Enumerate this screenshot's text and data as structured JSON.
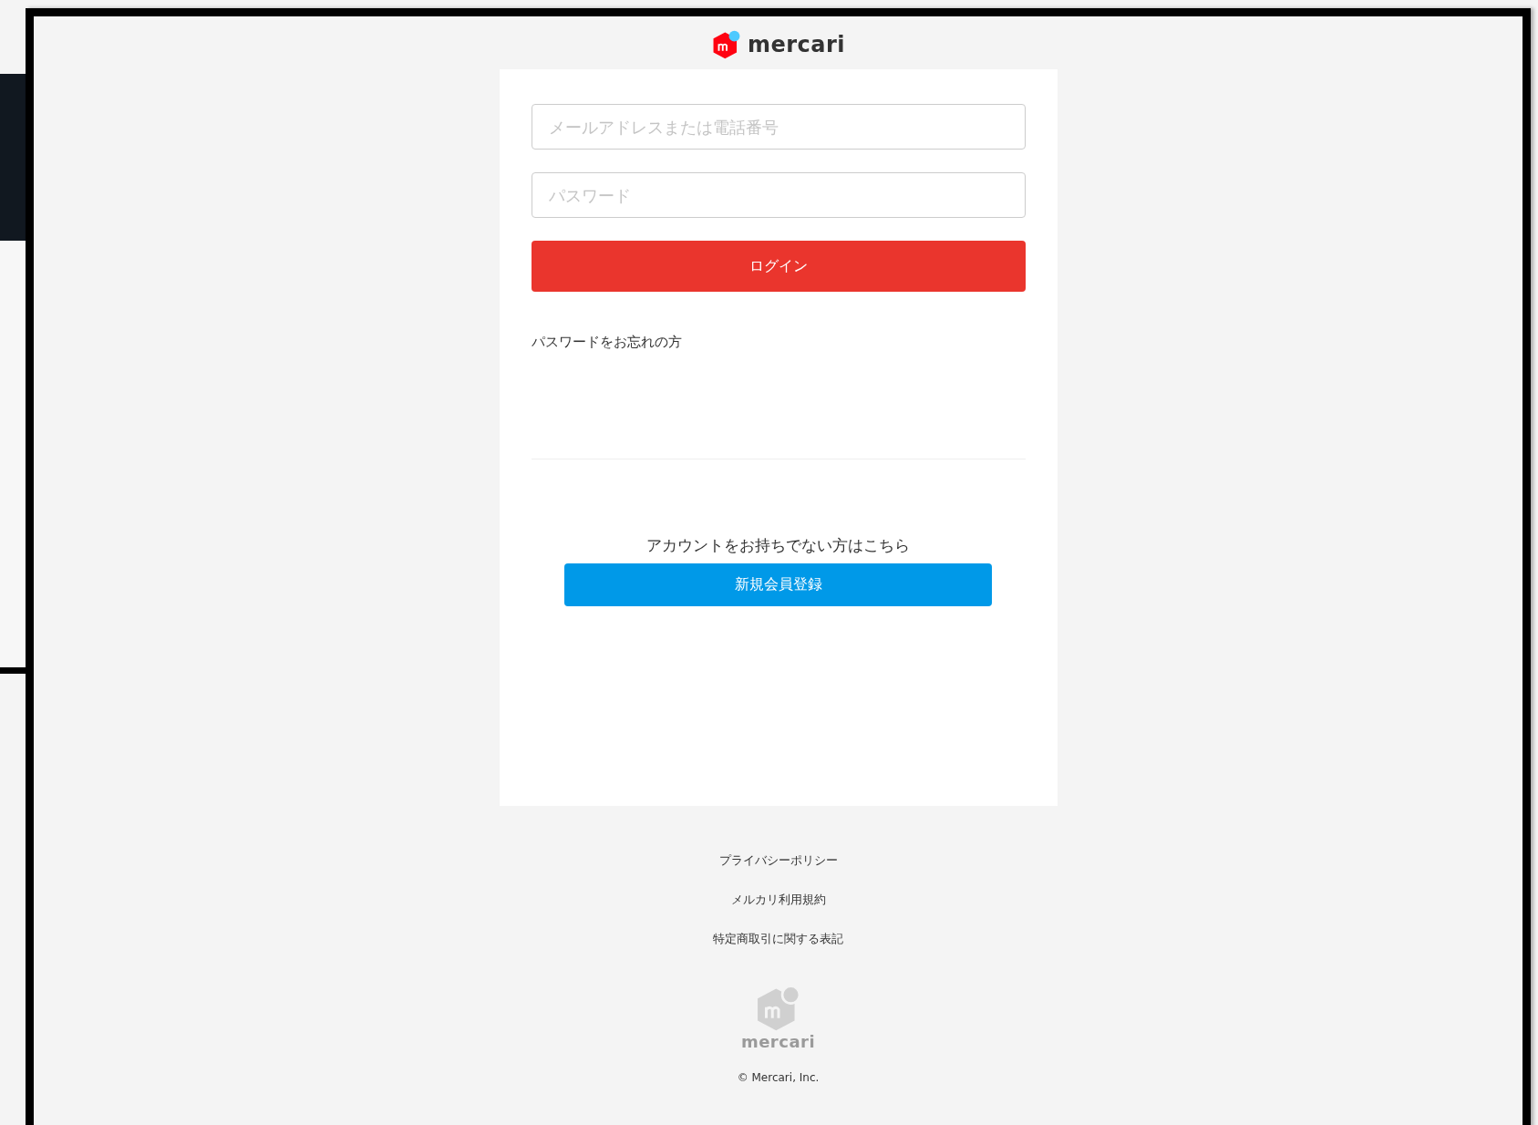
{
  "header": {
    "logo_text": "mercari"
  },
  "login_form": {
    "email": {
      "placeholder": "メールアドレスまたは電話番号"
    },
    "password": {
      "placeholder": "パスワード"
    },
    "login_button": "ログイン",
    "forgot_link": "パスワードをお忘れの方"
  },
  "signup": {
    "prompt": "アカウントをお持ちでない方はこちら",
    "button": "新規会員登録"
  },
  "footer": {
    "links": [
      "プライバシーポリシー",
      "メルカリ利用規約",
      "特定商取引に関する表記"
    ],
    "logo_text": "mercari",
    "copyright": "© Mercari, Inc."
  }
}
